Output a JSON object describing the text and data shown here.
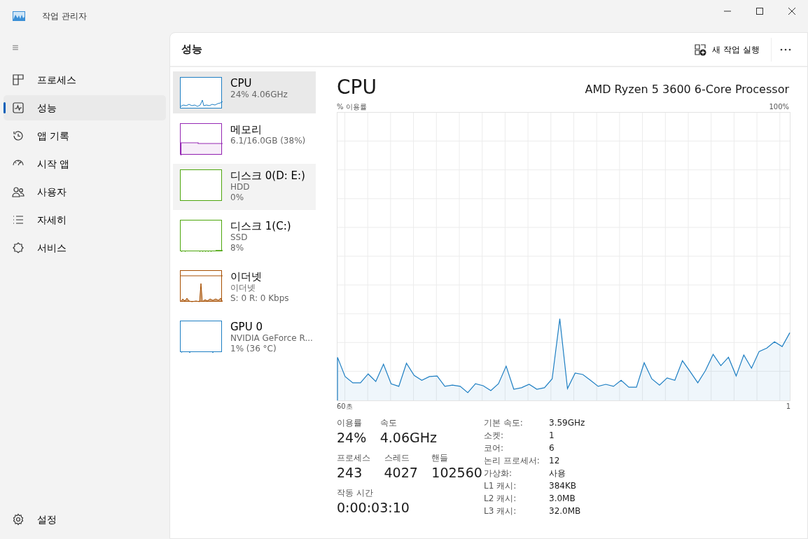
{
  "window": {
    "title": "작업 관리자"
  },
  "sidebar": {
    "items": [
      {
        "label": "프로세스",
        "selected": false
      },
      {
        "label": "성능",
        "selected": true
      },
      {
        "label": "앱 기록",
        "selected": false
      },
      {
        "label": "시작 앱",
        "selected": false
      },
      {
        "label": "사용자",
        "selected": false
      },
      {
        "label": "자세히",
        "selected": false
      },
      {
        "label": "서비스",
        "selected": false
      }
    ],
    "settings": {
      "label": "설정",
      "selected": false
    }
  },
  "header": {
    "title": "성능",
    "new_task_button": "새 작업 실행"
  },
  "devices": [
    {
      "kind": "cpu",
      "name": "CPU",
      "lines": [
        "24% 4.06GHz"
      ],
      "color": "#1e7fc3",
      "selected": true,
      "highlighted": false
    },
    {
      "kind": "memory",
      "name": "메모리",
      "lines": [
        "6.1/16.0GB (38%)"
      ],
      "color": "#9528b4",
      "selected": false,
      "highlighted": false
    },
    {
      "kind": "disk-empty",
      "name": "디스크 0(D: E:)",
      "lines": [
        "HDD",
        "0%"
      ],
      "color": "#4da60c",
      "selected": false,
      "highlighted": true
    },
    {
      "kind": "disk",
      "name": "디스크 1(C:)",
      "lines": [
        "SSD",
        "8%"
      ],
      "color": "#4da60c",
      "selected": false,
      "highlighted": false
    },
    {
      "kind": "network",
      "name": "이더넷",
      "lines": [
        "이더넷",
        "S: 0 R: 0 Kbps"
      ],
      "color": "#a74f01",
      "selected": false,
      "highlighted": false
    },
    {
      "kind": "gpu",
      "name": "GPU 0",
      "lines": [
        "NVIDIA GeForce R...",
        "1% (36 °C)"
      ],
      "color": "#1e7fc3",
      "selected": false,
      "highlighted": false
    }
  ],
  "detail": {
    "title": "CPU",
    "model": "AMD Ryzen 5 3600 6-Core Processor",
    "scale_max_label": "100%",
    "x_start_label": "60초",
    "x_end_label": "1",
    "usage_label": "% 이용률",
    "stats": [
      [
        {
          "label": "이용률",
          "value": "24%"
        },
        {
          "label": "속도",
          "value": "4.06GHz"
        }
      ],
      [
        {
          "label": "프로세스",
          "value": "243"
        },
        {
          "label": "스레드",
          "value": "4027"
        },
        {
          "label": "핸들",
          "value": "102560"
        }
      ],
      [
        {
          "label": "작동 시간",
          "value": "0:00:03:10"
        }
      ]
    ],
    "properties": [
      {
        "key": "기본 속도:",
        "value": "3.59GHz"
      },
      {
        "key": "소켓:",
        "value": "1"
      },
      {
        "key": "코어:",
        "value": "6"
      },
      {
        "key": "논리 프로세서:",
        "value": "12"
      },
      {
        "key": "가상화:",
        "value": "사용"
      },
      {
        "key": "L1 캐시:",
        "value": "384KB"
      },
      {
        "key": "L2 캐시:",
        "value": "3.0MB"
      },
      {
        "key": "L3 캐시:",
        "value": "32.0MB"
      }
    ]
  }
}
